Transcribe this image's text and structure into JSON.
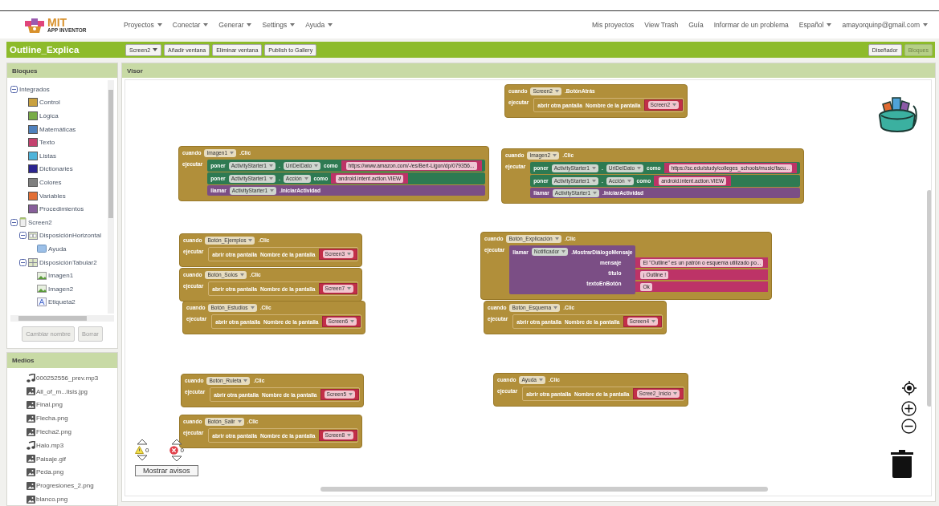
{
  "app": {
    "logo_title": "MIT",
    "logo_subtitle": "APP INVENTOR"
  },
  "menu": [
    {
      "label": "Proyectos",
      "dropdown": true
    },
    {
      "label": "Conectar",
      "dropdown": true
    },
    {
      "label": "Generar",
      "dropdown": true
    },
    {
      "label": "Settings",
      "dropdown": true
    },
    {
      "label": "Ayuda",
      "dropdown": true
    }
  ],
  "account_menu": [
    {
      "label": "Mis proyectos",
      "dropdown": false
    },
    {
      "label": "View Trash",
      "dropdown": false
    },
    {
      "label": "Guía",
      "dropdown": false
    },
    {
      "label": "Informar de un problema",
      "dropdown": false
    },
    {
      "label": "Español",
      "dropdown": true
    },
    {
      "label": "amayorquinp@gmail.com",
      "dropdown": true
    }
  ],
  "project": {
    "name": "Outline_Explica",
    "actions": [
      {
        "label": "Screen2",
        "dropdown": true
      },
      {
        "label": "Añadir ventana",
        "dropdown": false
      },
      {
        "label": "Eliminar ventana",
        "dropdown": false
      },
      {
        "label": "Publish to Gallery",
        "dropdown": false
      }
    ],
    "views": [
      {
        "label": "Diseñador",
        "selected": false
      },
      {
        "label": "Bloques",
        "selected": true
      }
    ]
  },
  "blocks_panel": {
    "title": "Bloques",
    "tree": [
      {
        "label": "Integrados",
        "kind": "category",
        "expanded": true,
        "children": [
          {
            "label": "Control",
            "kind": "drawer",
            "color": "#c9a13f"
          },
          {
            "label": "Lógica",
            "kind": "drawer",
            "color": "#79ac47"
          },
          {
            "label": "Matemáticas",
            "kind": "drawer",
            "color": "#4f81bd"
          },
          {
            "label": "Texto",
            "kind": "drawer",
            "color": "#c4426f"
          },
          {
            "label": "Listas",
            "kind": "drawer",
            "color": "#4fb3d9"
          },
          {
            "label": "Dictionaries",
            "kind": "drawer",
            "color": "#2b248f"
          },
          {
            "label": "Colores",
            "kind": "drawer",
            "color": "#7f7f7f"
          },
          {
            "label": "Variables",
            "kind": "drawer",
            "color": "#e26f35"
          },
          {
            "label": "Procedimientos",
            "kind": "drawer",
            "color": "#875f9a"
          }
        ]
      },
      {
        "label": "Screen2",
        "kind": "screen",
        "expanded": true,
        "children": [
          {
            "label": "DisposiciónHorizontal",
            "kind": "hbox",
            "expanded": true,
            "children": [
              {
                "label": "Ayuda",
                "kind": "button"
              }
            ]
          },
          {
            "label": "DisposiciónTabular2",
            "kind": "table",
            "expanded": true,
            "children": [
              {
                "label": "Imagen1",
                "kind": "image"
              },
              {
                "label": "Imagen2",
                "kind": "image"
              },
              {
                "label": "Etiqueta2",
                "kind": "label"
              }
            ]
          }
        ]
      }
    ],
    "buttons": [
      {
        "label": "Cambiar nombre",
        "disabled": true
      },
      {
        "label": "Borrar",
        "disabled": true
      }
    ]
  },
  "media_panel": {
    "title": "Medios",
    "items": [
      {
        "label": "000252556_prev.mp3",
        "kind": "audio"
      },
      {
        "label": "All_of_m...lisis.jpg",
        "kind": "image"
      },
      {
        "label": "Final.png",
        "kind": "image"
      },
      {
        "label": "Flecha.png",
        "kind": "image"
      },
      {
        "label": "Flecha2.png",
        "kind": "image"
      },
      {
        "label": "Halo.mp3",
        "kind": "audio"
      },
      {
        "label": "Paisaje.gif",
        "kind": "image"
      },
      {
        "label": "Peda.png",
        "kind": "image"
      },
      {
        "label": "Progresiones_2.png",
        "kind": "image"
      },
      {
        "label": "blanco.png",
        "kind": "image"
      }
    ]
  },
  "workspace": {
    "title": "Visor",
    "blocks": [
      {
        "kind": "event",
        "when": "cuando",
        "component": "Screen2",
        "event": ".BotónAtrás",
        "do": "ejecutar",
        "body": [
          {
            "kind": "open_screen",
            "label": "abrir otra pantalla",
            "param": "Nombre de la pantalla",
            "screen": "Screen2"
          }
        ]
      },
      {
        "kind": "event",
        "when": "cuando",
        "component": "Imagen1",
        "event": ".Clic",
        "do": "ejecutar",
        "body": [
          {
            "kind": "set",
            "verb": "poner",
            "component": "ActivityStarter1",
            "dot": ".",
            "property": "UriDelDato",
            "as": "como",
            "value": "https://www.amazon.com/-/es/Bert-Ligon/dp/079356..."
          },
          {
            "kind": "set",
            "verb": "poner",
            "component": "ActivityStarter1",
            "dot": ".",
            "property": "Acción",
            "as": "como",
            "value": "android.intent.action.VIEW"
          },
          {
            "kind": "call",
            "verb": "llamar",
            "component": "ActivityStarter1",
            "method": ".IniciarActividad"
          }
        ]
      },
      {
        "kind": "event",
        "when": "cuando",
        "component": "Imagen2",
        "event": ".Clic",
        "do": "ejecutar",
        "body": [
          {
            "kind": "set",
            "verb": "poner",
            "component": "ActivityStarter1",
            "dot": ".",
            "property": "UriDelDato",
            "as": "como",
            "value": "https://sc.edu/study/colleges_schools/music/facu..."
          },
          {
            "kind": "set",
            "verb": "poner",
            "component": "ActivityStarter1",
            "dot": ".",
            "property": "Acción",
            "as": "como",
            "value": "android.intent.action.VIEW"
          },
          {
            "kind": "call",
            "verb": "llamar",
            "component": "ActivityStarter1",
            "method": ".IniciarActividad"
          }
        ]
      },
      {
        "kind": "event",
        "when": "cuando",
        "component": "Botón_Ejemplos",
        "event": ".Clic",
        "do": "ejecutar",
        "body": [
          {
            "kind": "open_screen",
            "label": "abrir otra pantalla",
            "param": "Nombre de la pantalla",
            "screen": "Screen3"
          }
        ]
      },
      {
        "kind": "event",
        "when": "cuando",
        "component": "Botón_Solos",
        "event": ".Clic",
        "do": "ejecutar",
        "body": [
          {
            "kind": "open_screen",
            "label": "abrir otra pantalla",
            "param": "Nombre de la pantalla",
            "screen": "Screen7"
          }
        ]
      },
      {
        "kind": "event",
        "when": "cuando",
        "component": "Botón_Explicación",
        "event": ".Clic",
        "do": "ejecutar",
        "body": [
          {
            "kind": "call_args",
            "verb": "llamar",
            "component": "Notificador",
            "method": ".MostrarDiálogoMensaje",
            "args": [
              {
                "name": "mensaje",
                "value": "El \"Outline\" es un patrón o esquema utilizado po..."
              },
              {
                "name": "título",
                "value": "¡ Outline !"
              },
              {
                "name": "textoEnBotón",
                "value": "Ok"
              }
            ]
          }
        ]
      },
      {
        "kind": "event",
        "when": "cuando",
        "component": "Botón_Estudios",
        "event": ".Clic",
        "do": "ejecutar",
        "body": [
          {
            "kind": "open_screen",
            "label": "abrir otra pantalla",
            "param": "Nombre de la pantalla",
            "screen": "Screen6"
          }
        ]
      },
      {
        "kind": "event",
        "when": "cuando",
        "component": "Botón_Esquema",
        "event": ".Clic",
        "do": "ejecutar",
        "body": [
          {
            "kind": "open_screen",
            "label": "abrir otra pantalla",
            "param": "Nombre de la pantalla",
            "screen": "Screen4"
          }
        ]
      },
      {
        "kind": "event",
        "when": "cuando",
        "component": "Botón_Ruleta",
        "event": ".Clic",
        "do": "ejecutar",
        "body": [
          {
            "kind": "open_screen",
            "label": "abrir otra pantalla",
            "param": "Nombre de la pantalla",
            "screen": "Screen5"
          }
        ]
      },
      {
        "kind": "event",
        "when": "cuando",
        "component": "Ayuda",
        "event": ".Clic",
        "do": "ejecutar",
        "body": [
          {
            "kind": "open_screen",
            "label": "abrir otra pantalla",
            "param": "Nombre de la pantalla",
            "screen": "Scree2_Inicio"
          }
        ]
      },
      {
        "kind": "event",
        "when": "cuando",
        "component": "Botón_Salir",
        "event": ".Clic",
        "do": "ejecutar",
        "body": [
          {
            "kind": "open_screen",
            "label": "abrir otra pantalla",
            "param": "Nombre de la pantalla",
            "screen": "Screen8"
          }
        ]
      }
    ],
    "warnings": {
      "warning_count": "0",
      "error_count": "0",
      "button": "Mostrar avisos"
    }
  }
}
